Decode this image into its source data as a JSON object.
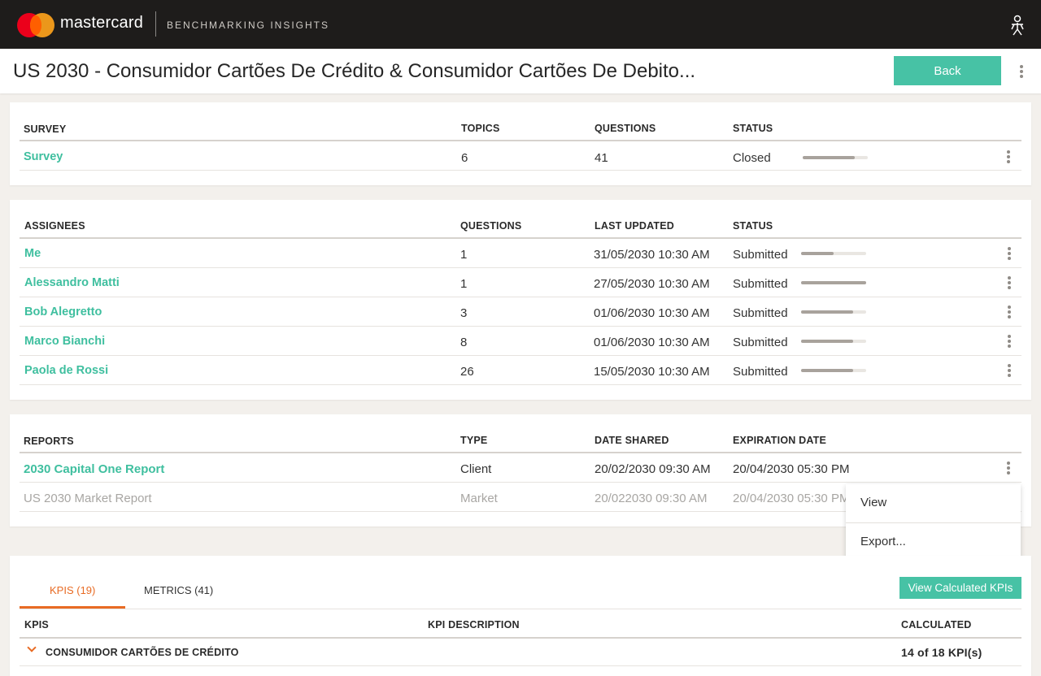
{
  "header": {
    "brand": "mastercard",
    "product": "BENCHMARKING INSIGHTS"
  },
  "titlebar": {
    "title": "US 2030 - Consumidor Cartões De Crédito & Consumidor Cartões De Debito...",
    "back_label": "Back"
  },
  "survey": {
    "headers": {
      "survey": "SURVEY",
      "topics": "TOPICS",
      "questions": "QUESTIONS",
      "status": "STATUS"
    },
    "rows": [
      {
        "name": "Survey",
        "topics": "6",
        "questions": "41",
        "status": "Closed",
        "progress": 0.8
      }
    ]
  },
  "assignees": {
    "headers": {
      "assignees": "ASSIGNEES",
      "questions": "QUESTIONS",
      "last_updated": "LAST UPDATED",
      "status": "STATUS"
    },
    "rows": [
      {
        "name": "Me",
        "questions": "1",
        "last_updated": "31/05/2030 10:30 AM",
        "status": "Submitted",
        "progress": 0.5
      },
      {
        "name": "Alessandro Matti",
        "questions": "1",
        "last_updated": "27/05/2030 10:30 AM",
        "status": "Submitted",
        "progress": 1.0
      },
      {
        "name": "Bob Alegretto",
        "questions": "3",
        "last_updated": "01/06/2030 10:30 AM",
        "status": "Submitted",
        "progress": 0.8
      },
      {
        "name": "Marco Bianchi",
        "questions": "8",
        "last_updated": "01/06/2030 10:30 AM",
        "status": "Submitted",
        "progress": 0.8
      },
      {
        "name": "Paola de Rossi",
        "questions": "26",
        "last_updated": "15/05/2030 10:30 AM",
        "status": "Submitted",
        "progress": 0.8
      }
    ]
  },
  "reports": {
    "headers": {
      "reports": "REPORTS",
      "type": "TYPE",
      "date_shared": "DATE SHARED",
      "expiration_date": "EXPIRATION DATE"
    },
    "rows": [
      {
        "name": "2030 Capital One Report",
        "type": "Client",
        "date_shared": "20/02/2030 09:30 AM",
        "expiration_date": "20/04/2030 05:30 PM"
      },
      {
        "name": "US 2030 Market Report",
        "type": "Market",
        "date_shared": "20/022030 09:30 AM",
        "expiration_date": "20/04/2030 05:30 PM"
      }
    ]
  },
  "context_menu": {
    "items": [
      "View",
      "Export..."
    ]
  },
  "kpis": {
    "tabs": [
      {
        "label": "KPIS (19)",
        "active": true
      },
      {
        "label": "METRICS (41)",
        "active": false
      }
    ],
    "view_button": "View Calculated KPIs",
    "headers": {
      "kpis": "KPIS",
      "description": "KPI DESCRIPTION",
      "calculated": "CALCULATED"
    },
    "groups": [
      {
        "name": "CONSUMIDOR CARTÕES DE CRÉDITO",
        "calculated": "14 of 18 KPI(s)"
      }
    ]
  },
  "colors": {
    "accent": "#47c2a5",
    "link": "#3fbf9f",
    "tab_active": "#e86b24",
    "topbar": "#1e1c1b"
  }
}
